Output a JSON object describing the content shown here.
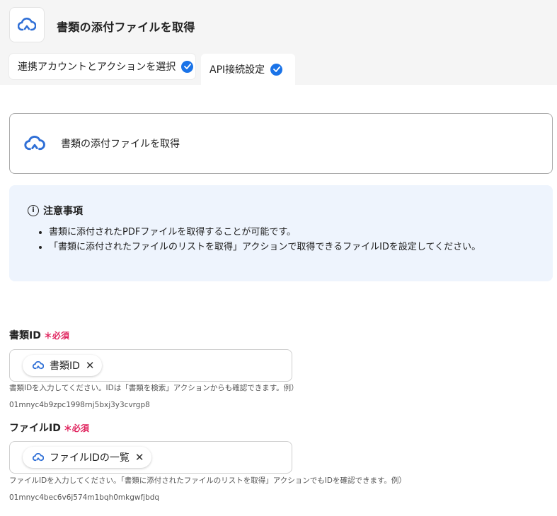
{
  "header": {
    "title": "書類の添付ファイルを取得",
    "icon": "cloud-sync-icon"
  },
  "tabs": [
    {
      "label": "連携アカウントとアクションを選択",
      "completed": true
    },
    {
      "label": "API接続設定",
      "completed": true
    }
  ],
  "action": {
    "label": "書類の添付ファイルを取得"
  },
  "notice": {
    "title": "注意事項",
    "items": [
      "書類に添付されたPDFファイルを取得することが可能です。",
      "「書類に添付されたファイルのリストを取得」アクションで取得できるファイルIDを設定してください。"
    ]
  },
  "fields": [
    {
      "label": "書類ID",
      "required": "必須",
      "chip": "書類ID",
      "help": "書類IDを入力してください。IDは「書類を検索」アクションからも確認できます。例）01mnyc4b9zpc1998rnj5bxj3y3cvrgp8"
    },
    {
      "label": "ファイルID",
      "required": "必須",
      "chip": "ファイルIDの一覧",
      "help": "ファイルIDを入力してください。「書類に添付されたファイルのリストを取得」アクションでもIDを確認できます。例）01mnyc4bec6v6j574m1bqh0mkgwfjbdq"
    }
  ],
  "colors": {
    "accent": "#1a73e8",
    "required": "#e0245e",
    "notice_bg": "#eef4fd"
  }
}
